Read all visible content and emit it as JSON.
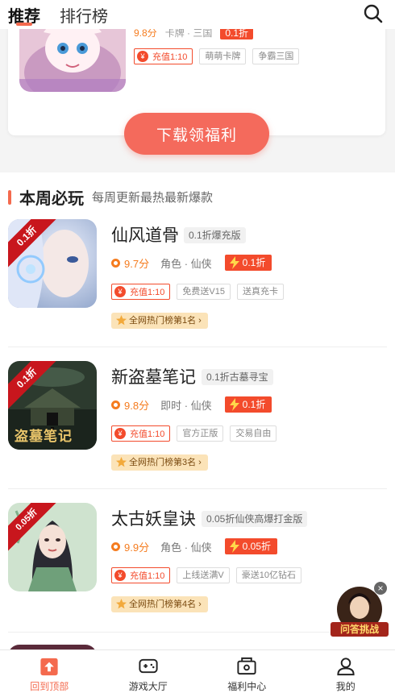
{
  "header": {
    "tabs": [
      {
        "label": "推荐",
        "active": true
      },
      {
        "label": "排行榜",
        "active": false
      }
    ]
  },
  "featured": {
    "score": "9.8分",
    "meta": "卡牌 · 三国",
    "discount": "0.1折",
    "tags": [
      "充值1:10",
      "萌萌卡牌",
      "争霸三国"
    ],
    "download_label": "下载领福利"
  },
  "section": {
    "title": "本周必玩",
    "subtitle": "每周更新最热最新爆款"
  },
  "games": [
    {
      "name": "仙风道骨",
      "edition": "0.1折爆充版",
      "ribbon": "0.1折",
      "score": "9.7分",
      "genre": "角色 · 仙侠",
      "discount": "0.1折",
      "tags": [
        "充值1:10",
        "免费送V15",
        "送真充卡"
      ],
      "rank": "全网热门榜第1名"
    },
    {
      "name": "新盗墓笔记",
      "edition": "0.1折古墓寻宝",
      "ribbon": "0.1折",
      "score": "9.8分",
      "genre": "即时 · 仙侠",
      "discount": "0.1折",
      "tags": [
        "充值1:10",
        "官方正版",
        "交易自由"
      ],
      "rank": "全网热门榜第3名",
      "cover_text": "盗墓笔记"
    },
    {
      "name": "太古妖皇诀",
      "edition": "0.05折仙侠高爆打金版",
      "ribbon": "0.05折",
      "score": "9.9分",
      "genre": "角色 · 仙侠",
      "discount": "0.05折",
      "tags": [
        "充值1:10",
        "上线送满V",
        "豪送10亿钻石"
      ],
      "rank": "全网热门榜第4名"
    }
  ],
  "promo": {
    "badge": "问答挑战",
    "close": "×"
  },
  "bottom_nav": [
    {
      "label": "回到顶部",
      "icon": "arrow-up-icon",
      "active": true
    },
    {
      "label": "游戏大厅",
      "icon": "gamepad-icon",
      "active": false
    },
    {
      "label": "福利中心",
      "icon": "gift-box-icon",
      "active": false
    },
    {
      "label": "我的",
      "icon": "user-icon",
      "active": false
    }
  ],
  "colors": {
    "accent": "#f46a4e",
    "discount": "#f34b2c",
    "score": "#f57c1f"
  }
}
